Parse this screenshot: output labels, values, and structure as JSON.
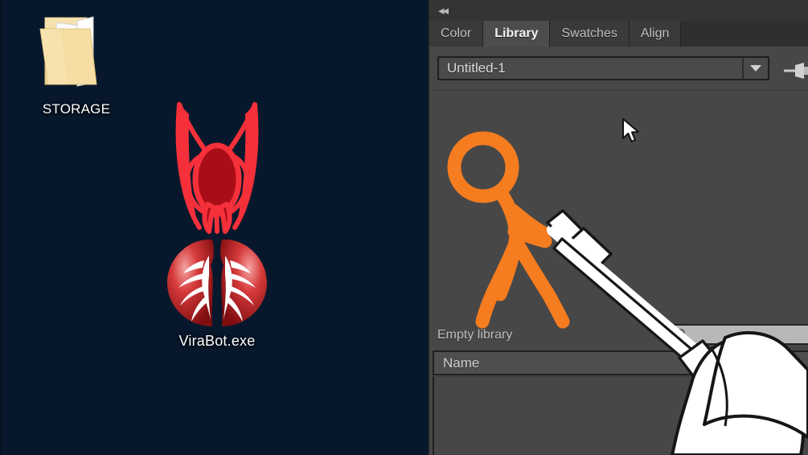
{
  "desktop": {
    "background_color": "#0a2c4d",
    "icons": [
      {
        "label": "STORAGE",
        "icon": "folder-open-icon"
      },
      {
        "label": "ViraBot.exe",
        "icon": "virabot-malware-icon"
      }
    ]
  },
  "panel": {
    "collapse_icon": "◂◂",
    "tabs": [
      {
        "label": "Color",
        "active": false
      },
      {
        "label": "Library",
        "active": true
      },
      {
        "label": "Swatches",
        "active": false
      },
      {
        "label": "Align",
        "active": false
      }
    ],
    "library_selector": {
      "value": "Untitled-1",
      "dropdown_icon": "chevron-down-icon"
    },
    "pin_icon": "pin-icon",
    "status_text": "Empty library",
    "search": {
      "value": "",
      "placeholder": "",
      "icon": "search-icon"
    },
    "columns": [
      "Name"
    ],
    "rows": []
  },
  "overlay": {
    "stick_figure_color": "#f57c1f",
    "weapon": "white-mallet",
    "cursor_icon": "arrow-cursor"
  }
}
